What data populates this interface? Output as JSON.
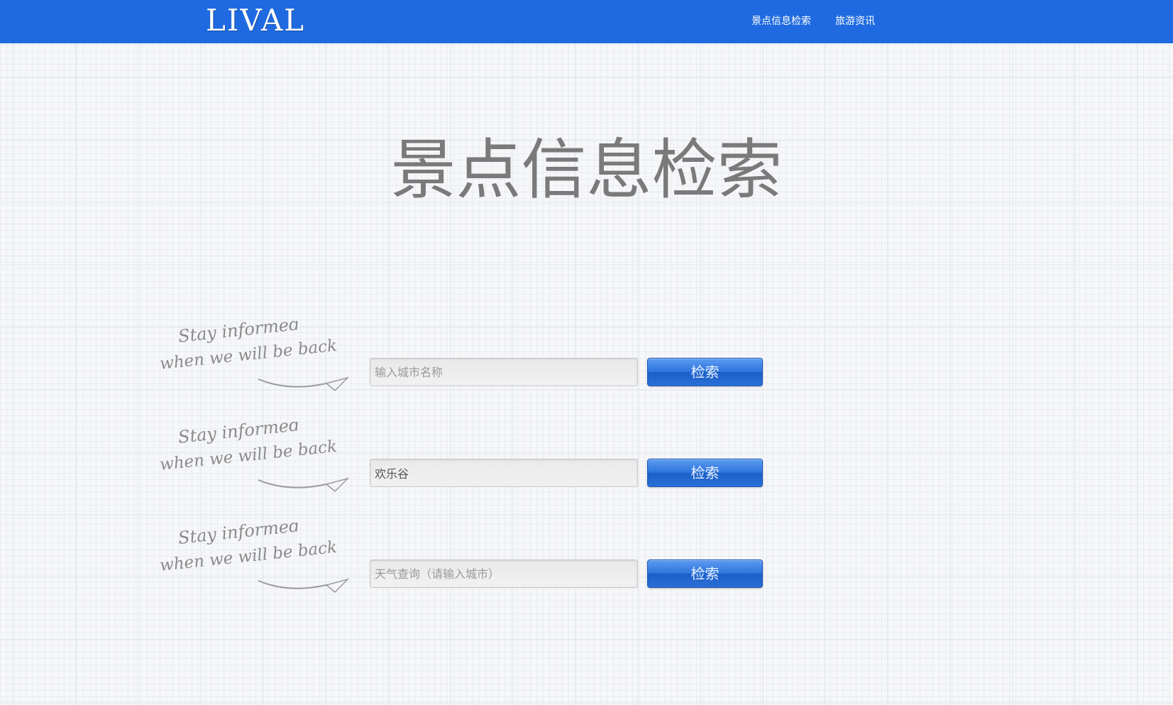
{
  "header": {
    "logo": "LIVAL",
    "nav": [
      {
        "label": "景点信息检索"
      },
      {
        "label": "旅游资讯"
      }
    ]
  },
  "main": {
    "title": "景点信息检索",
    "decor_text_line1": "Stay informed",
    "decor_text_line2": "when we will be back",
    "rows": [
      {
        "input_value": "",
        "input_placeholder": "输入城市名称",
        "button_label": "检索"
      },
      {
        "input_value": "欢乐谷",
        "input_placeholder": "",
        "button_label": "检索"
      },
      {
        "input_value": "",
        "input_placeholder": "天气查询（请输入城市）",
        "button_label": "检索"
      }
    ]
  },
  "colors": {
    "navbar": "#1f6ae0",
    "button": "#2d75dc",
    "title_text": "#7a7a7a"
  }
}
